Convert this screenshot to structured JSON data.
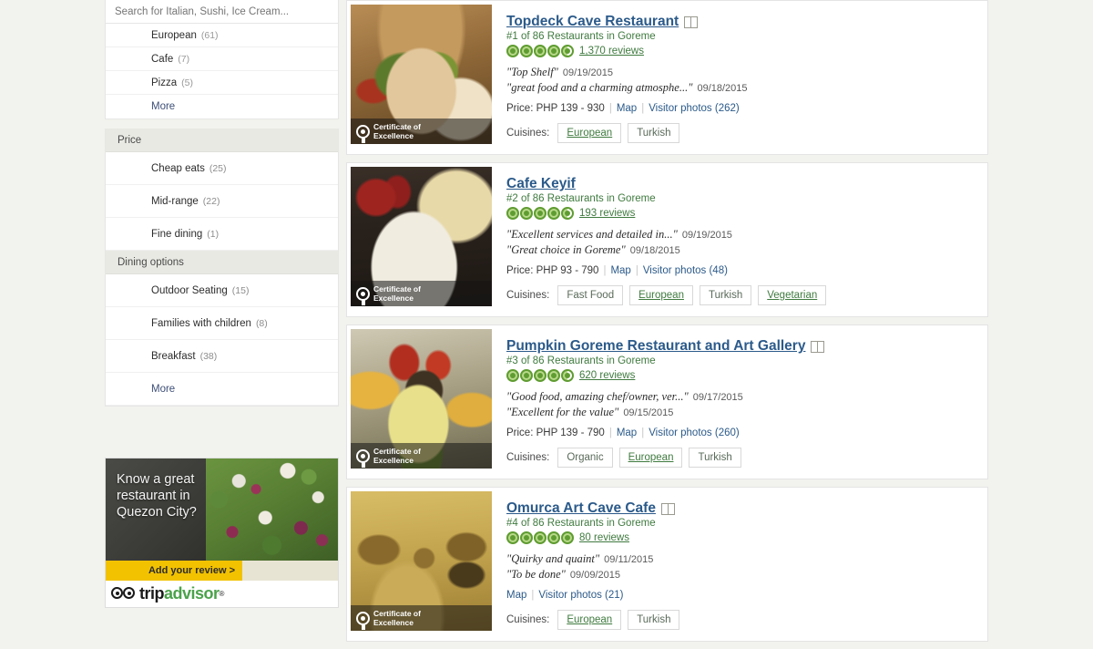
{
  "sidebar": {
    "search": {
      "placeholder": "Search for Italian, Sushi, Ice Cream..."
    },
    "cuisine_filters": [
      {
        "label": "European",
        "count": "(61)"
      },
      {
        "label": "Cafe",
        "count": "(7)"
      },
      {
        "label": "Pizza",
        "count": "(5)"
      }
    ],
    "cuisine_more": "More",
    "price_section": {
      "title": "Price"
    },
    "price_filters": [
      {
        "label": "Cheap eats",
        "count": "(25)"
      },
      {
        "label": "Mid-range",
        "count": "(22)"
      },
      {
        "label": "Fine dining",
        "count": "(1)"
      }
    ],
    "dining_section": {
      "title": "Dining options"
    },
    "dining_filters": [
      {
        "label": "Outdoor Seating",
        "count": "(15)"
      },
      {
        "label": "Families with children",
        "count": "(8)"
      },
      {
        "label": "Breakfast",
        "count": "(38)"
      }
    ],
    "dining_more": "More"
  },
  "ad": {
    "headline_line1": "Know a great",
    "headline_line2": "restaurant in",
    "headline_line3": "Quezon City?",
    "cta": "Add your review >",
    "logo_trip": "trip",
    "logo_advisor": "advisor",
    "logo_reg": "®"
  },
  "listings": [
    {
      "name": "Topdeck Cave Restaurant",
      "has_menu_icon": true,
      "rank": "#1 of 86 Restaurants in Goreme",
      "rating": 4.5,
      "reviews": "1,370 reviews",
      "photo_badge_line1": "Certificate of",
      "photo_badge_line2": "Excellence",
      "quotes": [
        {
          "text": "\"Top Shelf\"",
          "date": "09/19/2015"
        },
        {
          "text": "\"great food and a charming atmosphe...\"",
          "date": "09/18/2015"
        }
      ],
      "price": "Price: PHP 139 - 930",
      "map_label": "Map",
      "photos_label": "Visitor photos (262)",
      "cuisines_label": "Cuisines:",
      "cuisines": [
        {
          "label": "European",
          "style": "link"
        },
        {
          "label": "Turkish",
          "style": "plain"
        }
      ]
    },
    {
      "name": "Cafe Keyif",
      "has_menu_icon": false,
      "rank": "#2 of 86 Restaurants in Goreme",
      "rating": 4.5,
      "reviews": "193 reviews",
      "photo_badge_line1": "Certificate of",
      "photo_badge_line2": "Excellence",
      "quotes": [
        {
          "text": "\"Excellent services and detailed in...\"",
          "date": "09/19/2015"
        },
        {
          "text": "\"Great choice in Goreme\"",
          "date": "09/18/2015"
        }
      ],
      "price": "Price: PHP 93 - 790",
      "map_label": "Map",
      "photos_label": "Visitor photos (48)",
      "cuisines_label": "Cuisines:",
      "cuisines": [
        {
          "label": "Fast Food",
          "style": "plain"
        },
        {
          "label": "European",
          "style": "link"
        },
        {
          "label": "Turkish",
          "style": "plain"
        },
        {
          "label": "Vegetarian",
          "style": "link"
        }
      ]
    },
    {
      "name": "Pumpkin Goreme Restaurant and Art Gallery",
      "has_menu_icon": true,
      "rank": "#3 of 86 Restaurants in Goreme",
      "rating": 4.5,
      "reviews": "620 reviews",
      "photo_badge_line1": "Certificate of",
      "photo_badge_line2": "Excellence",
      "quotes": [
        {
          "text": "\"Good food, amazing chef/owner, ver...\"",
          "date": "09/17/2015"
        },
        {
          "text": "\"Excellent for the value\"",
          "date": "09/15/2015"
        }
      ],
      "price": "Price: PHP 139 - 790",
      "map_label": "Map",
      "photos_label": "Visitor photos (260)",
      "cuisines_label": "Cuisines:",
      "cuisines": [
        {
          "label": "Organic",
          "style": "plain"
        },
        {
          "label": "European",
          "style": "link"
        },
        {
          "label": "Turkish",
          "style": "plain"
        }
      ]
    },
    {
      "name": "Omurca Art Cave Cafe",
      "has_menu_icon": true,
      "rank": "#4 of 86 Restaurants in Goreme",
      "rating": 5.0,
      "reviews": "80 reviews",
      "photo_badge_line1": "Certificate of",
      "photo_badge_line2": "Excellence",
      "quotes": [
        {
          "text": "\"Quirky and quaint\"",
          "date": "09/11/2015"
        },
        {
          "text": "\"To be done\"",
          "date": "09/09/2015"
        }
      ],
      "price": "",
      "map_label": "Map",
      "photos_label": "Visitor photos (21)",
      "cuisines_label": "Cuisines:",
      "cuisines": [
        {
          "label": "European",
          "style": "link"
        },
        {
          "label": "Turkish",
          "style": "plain"
        }
      ]
    }
  ],
  "colors": {
    "page_bg": "#f2f2ee",
    "link_blue": "#2b5a8a",
    "green": "#3f7a3f",
    "bubble_green": "#5f9c31",
    "cta_yellow": "#f2c200"
  }
}
